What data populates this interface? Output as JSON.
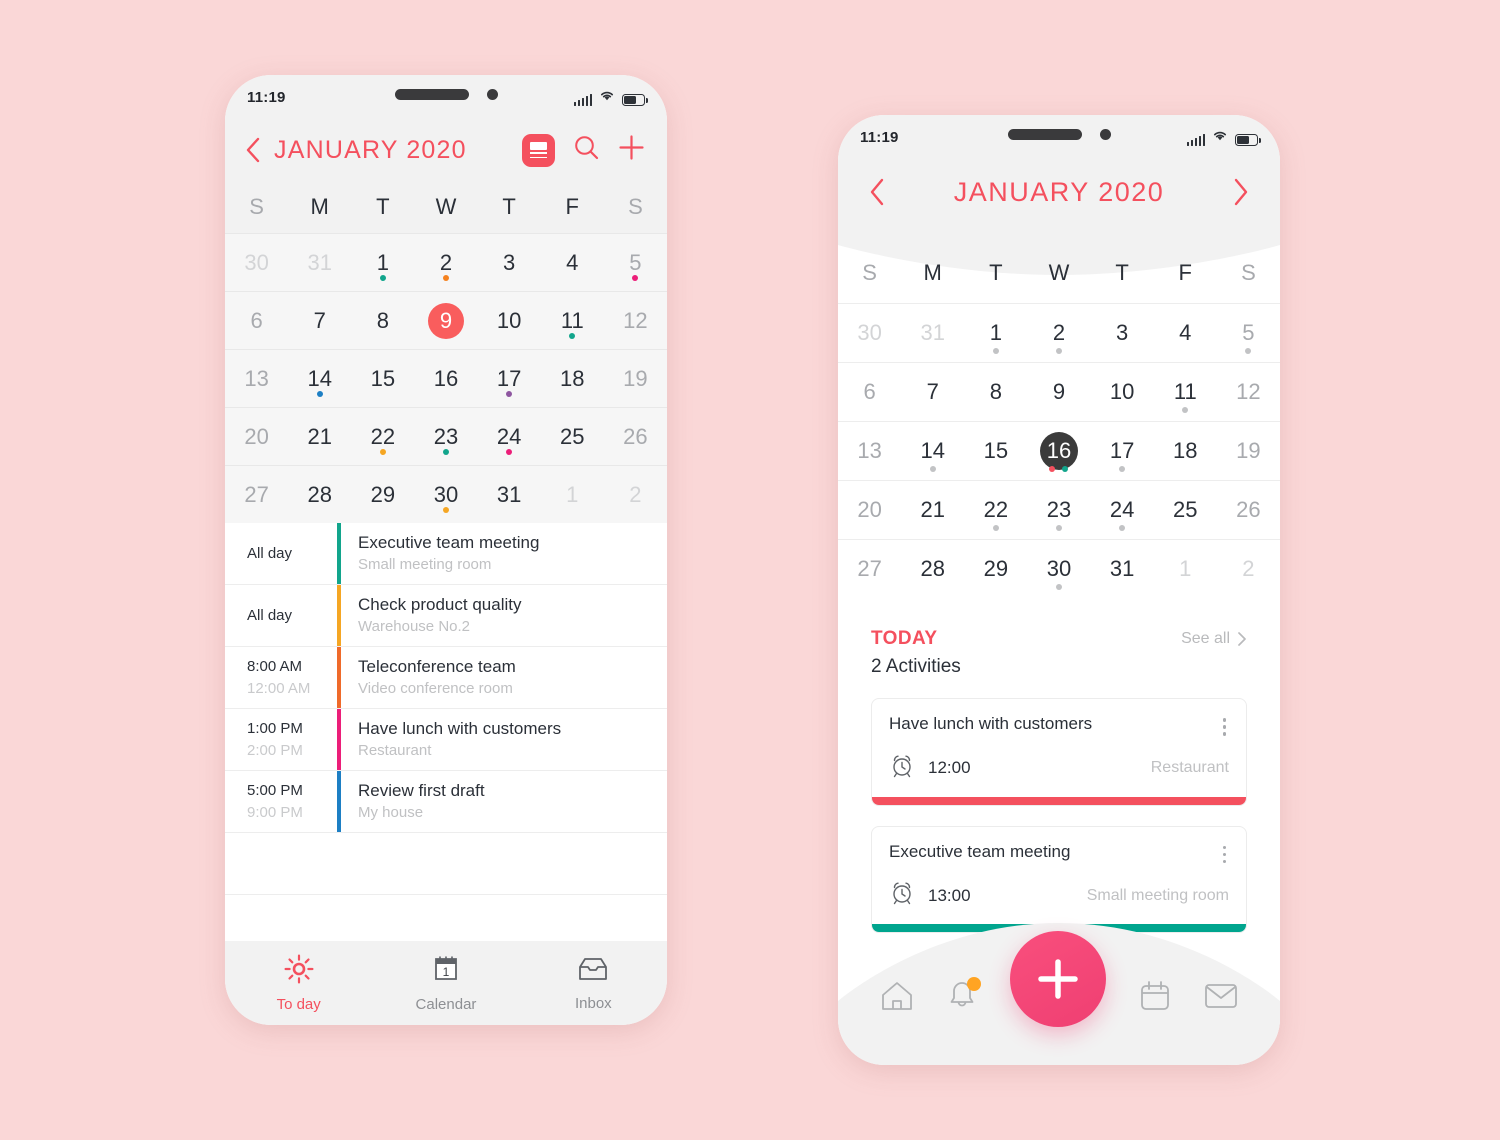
{
  "page": {
    "background_color": "#fad7d7"
  },
  "palette": {
    "accent_red": "#f4505e",
    "today_red": "#f95d5d",
    "teal": "#12a58c",
    "amber": "#f5a623",
    "orange": "#ef6a2a",
    "magenta": "#ec1e79",
    "blue": "#1d7fc4",
    "dark_pill": "#3b3b3b",
    "fab_pink": "#ef3f72",
    "badge_orange": "#ffa423"
  },
  "phone_left": {
    "status_bar": {
      "time": "11:19",
      "icons": [
        "signal-icon",
        "wifi-icon",
        "battery-icon"
      ]
    },
    "header": {
      "back_label": "back-chevron",
      "month": "JANUARY",
      "year": "2020",
      "title": "JANUARY  2020",
      "actions": [
        "list-view-icon",
        "search-icon",
        "add-icon"
      ]
    },
    "weekdays": [
      "S",
      "M",
      "T",
      "W",
      "T",
      "F",
      "S"
    ],
    "calendar": {
      "selected_day": 9,
      "weeks": [
        [
          {
            "d": "30",
            "out": true
          },
          {
            "d": "31",
            "out": true
          },
          {
            "d": "1",
            "dot": "#12a58c"
          },
          {
            "d": "2",
            "dot": "#f5821f"
          },
          {
            "d": "3"
          },
          {
            "d": "4"
          },
          {
            "d": "5",
            "weekend": true,
            "dot": "#ec1e79"
          }
        ],
        [
          {
            "d": "6",
            "weekend": true
          },
          {
            "d": "7"
          },
          {
            "d": "8"
          },
          {
            "d": "9",
            "today": true
          },
          {
            "d": "10"
          },
          {
            "d": "11",
            "dot": "#12a58c"
          },
          {
            "d": "12",
            "weekend": true
          }
        ],
        [
          {
            "d": "13",
            "weekend": true
          },
          {
            "d": "14",
            "dot": "#1d7fc4"
          },
          {
            "d": "15"
          },
          {
            "d": "16"
          },
          {
            "d": "17",
            "dot": "#8e56a0"
          },
          {
            "d": "18"
          },
          {
            "d": "19",
            "weekend": true
          }
        ],
        [
          {
            "d": "20",
            "weekend": true
          },
          {
            "d": "21"
          },
          {
            "d": "22",
            "dot": "#f5a623"
          },
          {
            "d": "23",
            "dot": "#12a58c"
          },
          {
            "d": "24",
            "dot": "#ec1e79"
          },
          {
            "d": "25"
          },
          {
            "d": "26",
            "weekend": true
          }
        ],
        [
          {
            "d": "27",
            "weekend": true
          },
          {
            "d": "28"
          },
          {
            "d": "29"
          },
          {
            "d": "30",
            "dot": "#f5a623"
          },
          {
            "d": "31"
          },
          {
            "d": "1",
            "out": true
          },
          {
            "d": "2",
            "out": true
          }
        ]
      ]
    },
    "events": [
      {
        "start": "All day",
        "end": "",
        "title": "Executive team meeting",
        "location": "Small meeting room",
        "color": "#12a58c"
      },
      {
        "start": "All day",
        "end": "",
        "title": "Check product quality",
        "location": "Warehouse  No.2",
        "color": "#f5a623"
      },
      {
        "start": "8:00 AM",
        "end": "12:00 AM",
        "title": "Teleconference team",
        "location": "Video conference room",
        "color": "#ef6a2a"
      },
      {
        "start": "1:00 PM",
        "end": "2:00 PM",
        "title": "Have lunch with customers",
        "location": "Restaurant",
        "color": "#ec1e79"
      },
      {
        "start": "5:00 PM",
        "end": "9:00 PM",
        "title": "Review first draft",
        "location": "My house",
        "color": "#1d7fc4"
      }
    ],
    "tabs": [
      {
        "label": "To day",
        "icon": "sun-icon",
        "active": true
      },
      {
        "label": "Calendar",
        "icon": "calendar-icon",
        "active": false
      },
      {
        "label": "Inbox",
        "icon": "inbox-icon",
        "active": false
      }
    ]
  },
  "phone_right": {
    "status_bar": {
      "time": "11:19",
      "icons": [
        "signal-icon",
        "wifi-icon",
        "battery-icon"
      ]
    },
    "header": {
      "prev_label": "prev-month-chevron",
      "next_label": "next-month-chevron",
      "month": "JANUARY",
      "year": "2020",
      "title": "JANUARY  2020"
    },
    "weekdays": [
      "S",
      "M",
      "T",
      "W",
      "T",
      "F",
      "S"
    ],
    "calendar": {
      "selected_day": 16,
      "weeks": [
        [
          {
            "d": "30",
            "out": true
          },
          {
            "d": "31",
            "out": true
          },
          {
            "d": "1",
            "dots": [
              "#c2c3c5"
            ]
          },
          {
            "d": "2",
            "dots": [
              "#c2c3c5"
            ]
          },
          {
            "d": "3"
          },
          {
            "d": "4"
          },
          {
            "d": "5",
            "weekend": true,
            "dots": [
              "#c2c3c5"
            ]
          }
        ],
        [
          {
            "d": "6",
            "weekend": true
          },
          {
            "d": "7"
          },
          {
            "d": "8"
          },
          {
            "d": "9"
          },
          {
            "d": "10"
          },
          {
            "d": "11",
            "dots": [
              "#c2c3c5"
            ]
          },
          {
            "d": "12",
            "weekend": true
          }
        ],
        [
          {
            "d": "13",
            "weekend": true
          },
          {
            "d": "14",
            "dots": [
              "#c2c3c5"
            ]
          },
          {
            "d": "15"
          },
          {
            "d": "16",
            "selected": true,
            "dots": [
              "#f4505e",
              "#12a58c"
            ]
          },
          {
            "d": "17",
            "dots": [
              "#c2c3c5"
            ]
          },
          {
            "d": "18"
          },
          {
            "d": "19",
            "weekend": true
          }
        ],
        [
          {
            "d": "20",
            "weekend": true
          },
          {
            "d": "21"
          },
          {
            "d": "22",
            "dots": [
              "#c2c3c5"
            ]
          },
          {
            "d": "23",
            "dots": [
              "#c2c3c5"
            ]
          },
          {
            "d": "24",
            "dots": [
              "#c2c3c5"
            ]
          },
          {
            "d": "25"
          },
          {
            "d": "26",
            "weekend": true
          }
        ],
        [
          {
            "d": "27",
            "weekend": true
          },
          {
            "d": "28"
          },
          {
            "d": "29"
          },
          {
            "d": "30",
            "dots": [
              "#c2c3c5"
            ]
          },
          {
            "d": "31"
          },
          {
            "d": "1",
            "out": true
          },
          {
            "d": "2",
            "out": true
          }
        ]
      ]
    },
    "today_section": {
      "label": "TODAY",
      "see_all": "See all",
      "activity_count": "2 Activities"
    },
    "cards": [
      {
        "title": "Have lunch with customers",
        "time": "12:00",
        "location": "Restaurant",
        "color": "#f4505e",
        "alarm_icon": "alarm-clock-icon",
        "menu_icon": "kebab-menu-icon"
      },
      {
        "title": "Executive team meeting",
        "time": "13:00",
        "location": "Small meeting room",
        "color": "#00a58e",
        "alarm_icon": "alarm-clock-icon",
        "menu_icon": "kebab-menu-icon"
      }
    ],
    "tabbar": {
      "items": [
        "home-icon",
        "bell-icon",
        "add-icon",
        "calendar-icon",
        "mail-icon"
      ],
      "bell_has_badge": true
    }
  }
}
